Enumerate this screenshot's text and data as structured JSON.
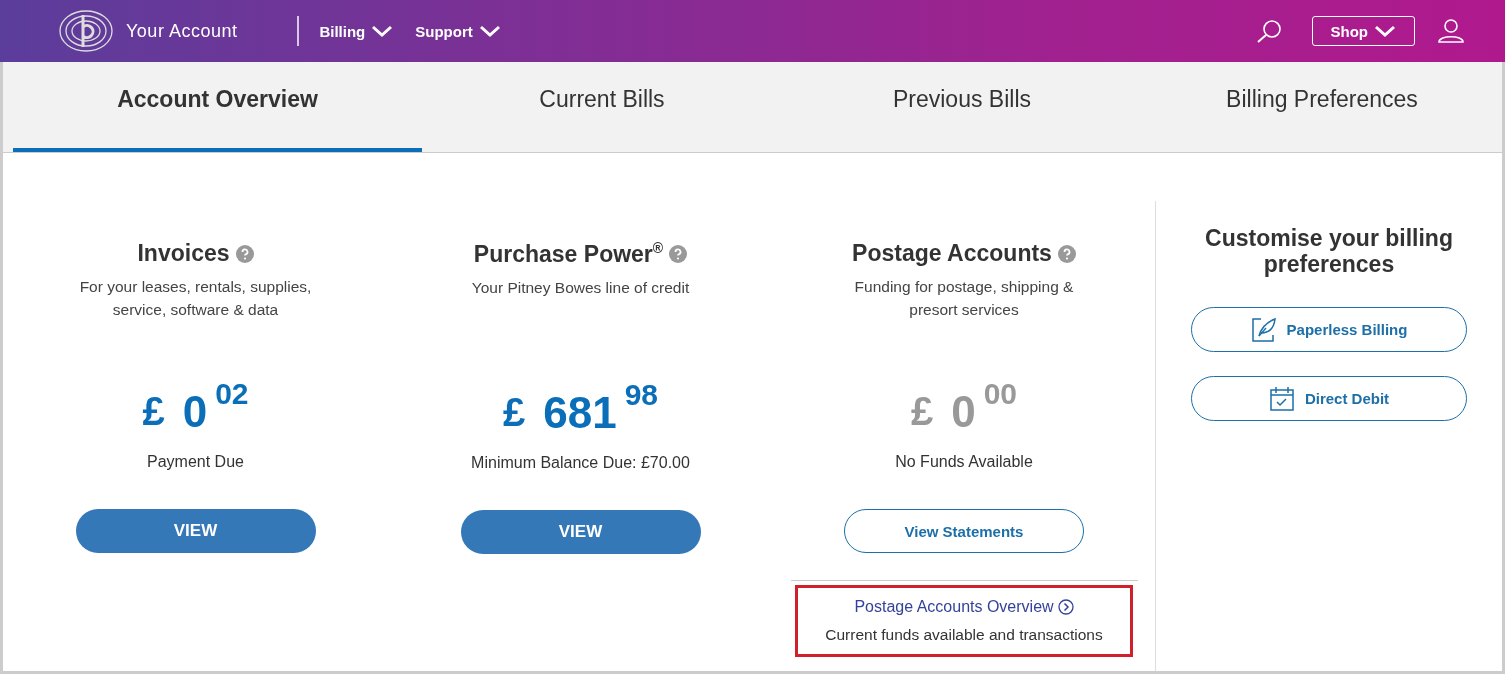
{
  "header": {
    "brand": "Your Account",
    "menus": [
      {
        "label": "Billing"
      },
      {
        "label": "Support"
      }
    ],
    "shop": "Shop"
  },
  "tabs": [
    {
      "label": "Account Overview",
      "selected": true
    },
    {
      "label": "Current Bills",
      "selected": false
    },
    {
      "label": "Previous Bills",
      "selected": false
    },
    {
      "label": "Billing Preferences",
      "selected": false
    }
  ],
  "cards": [
    {
      "title": "Invoices",
      "description": "For your leases, rentals, supplies, service, software & data",
      "amount": {
        "currency": "£",
        "whole": "0",
        "cents": "02",
        "empty": false
      },
      "caption": "Payment Due",
      "button": {
        "label": "VIEW",
        "kind": "filled"
      }
    },
    {
      "title": "Purchase Power$^{®}$",
      "description": "Your Pitney Bowes line of credit",
      "amount": {
        "currency": "£",
        "whole": "681",
        "cents": "98",
        "empty": false
      },
      "caption": "Minimum Balance Due: £70.00",
      "button": {
        "label": "VIEW",
        "kind": "filled"
      }
    },
    {
      "title": "Postage Accounts",
      "description": "Funding for postage, shipping & presort services",
      "amount": {
        "currency": "£",
        "whole": "0",
        "cents": "00",
        "empty": true
      },
      "caption": "No Funds Available",
      "button": {
        "label": "View Statements",
        "kind": "outline"
      },
      "footer": {
        "link": "Postage Accounts Overview",
        "note": "Current funds available and transactions",
        "highlighted": true
      }
    }
  ],
  "preferences": {
    "title": "Customise your billing preferences",
    "buttons": [
      {
        "label": "Paperless Billing",
        "kind": "paperless"
      },
      {
        "label": "Direct Debit",
        "kind": "calendar"
      }
    ]
  }
}
